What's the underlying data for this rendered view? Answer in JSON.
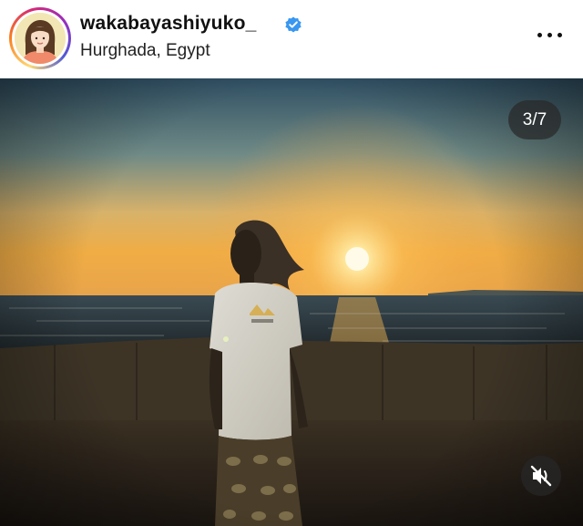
{
  "post": {
    "username": "wakabayashiyuko_",
    "verified": true,
    "location": "Hurghada, Egypt",
    "carousel_counter": "3/7"
  },
  "icons": {
    "verified": "verified-badge-icon",
    "more": "more-options-icon",
    "mute": "volume-muted-icon"
  },
  "colors": {
    "verified_blue": "#3897f0",
    "counter_bg": "#2a2a2a"
  }
}
